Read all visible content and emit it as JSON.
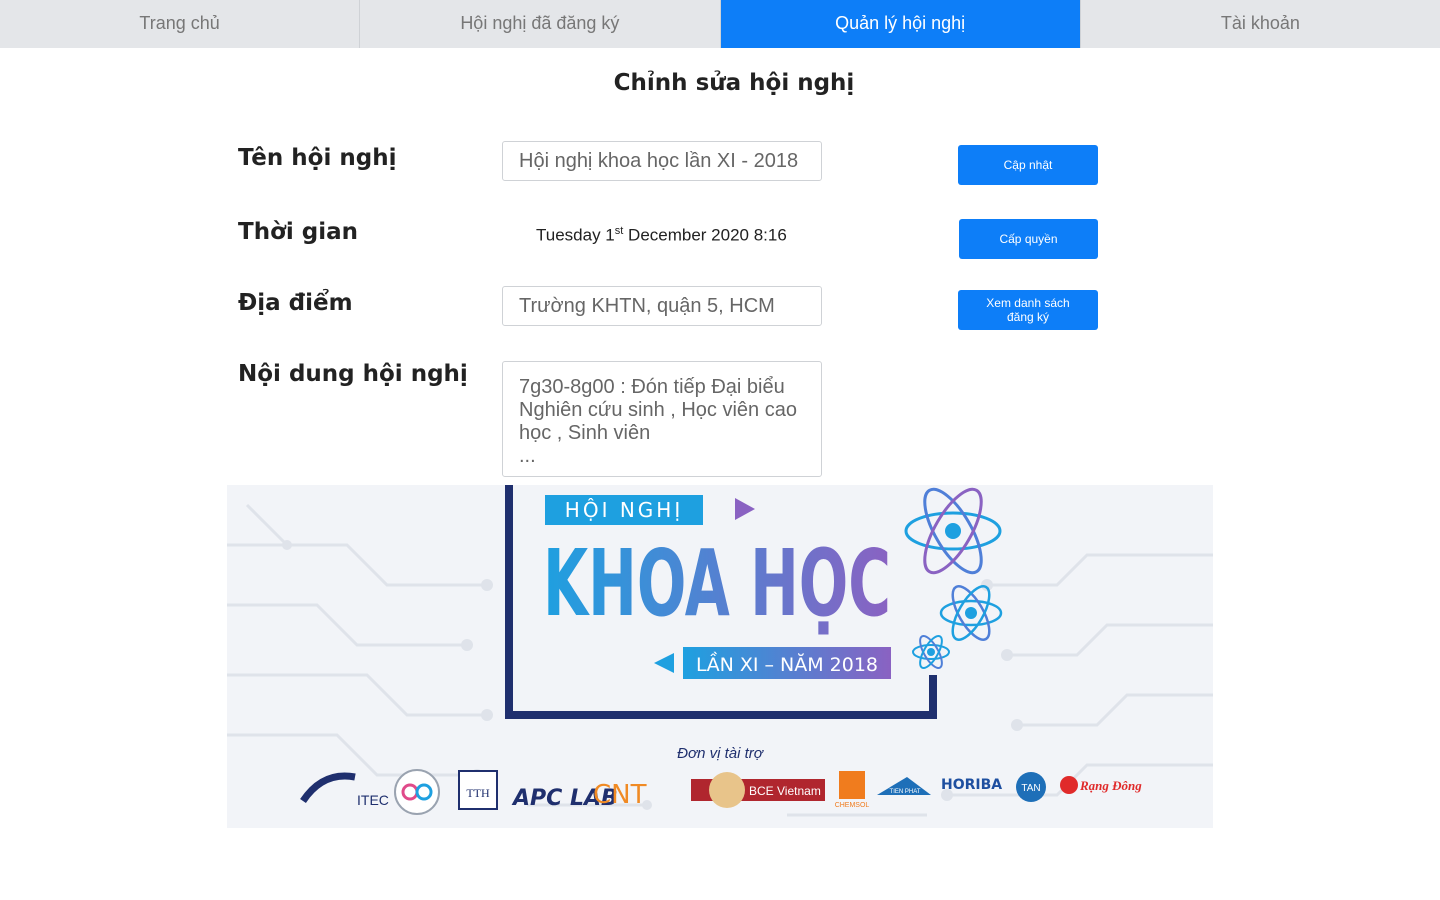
{
  "nav": {
    "tabs": [
      {
        "label": "Trang chủ"
      },
      {
        "label": "Hội nghị đã đăng ký"
      },
      {
        "label": "Quản lý hội nghị"
      },
      {
        "label": "Tài khoản"
      }
    ],
    "active_index": 2
  },
  "page": {
    "title": "Chỉnh sửa hội nghị"
  },
  "form": {
    "name_label": "Tên hội nghị",
    "name_value": "Hội nghị khoa học lần XI - 2018",
    "time_label": "Thời gian",
    "time_prefix": "Tuesday 1",
    "time_ordinal": "st",
    "time_suffix": " December 2020 8:16",
    "place_label": "Địa điểm",
    "place_value": "Trường KHTN, quận 5, HCM",
    "content_label": "Nội dung hội nghị",
    "content_value": "7g30-8g00 : Đón tiếp Đại biểu Nghiên cứu sinh , Học viên cao học , Sinh viên\n..."
  },
  "actions": {
    "update_label": "Cập nhật",
    "grant_label": "Cấp quyền",
    "view_list_label": "Xem danh sách đăng ký"
  },
  "banner": {
    "top_label": "HỘI NGHỊ",
    "main_title": "KHOA HỌC",
    "edition": "LẦN XI – NĂM 2018",
    "sponsors_label": "Đơn vị tài trợ",
    "sponsors": [
      "ITEC",
      "TTH",
      "APC LAB",
      "CNT",
      "BCE Vietnam",
      "CHEMSOL",
      "TIEN PHAT",
      "HORIBA",
      "TAN",
      "Rạng Đông"
    ],
    "colors": {
      "navy": "#1f2f6e",
      "cyan": "#1ea0e0",
      "purple": "#8a62c2",
      "accent": "#0d7ef8"
    }
  }
}
